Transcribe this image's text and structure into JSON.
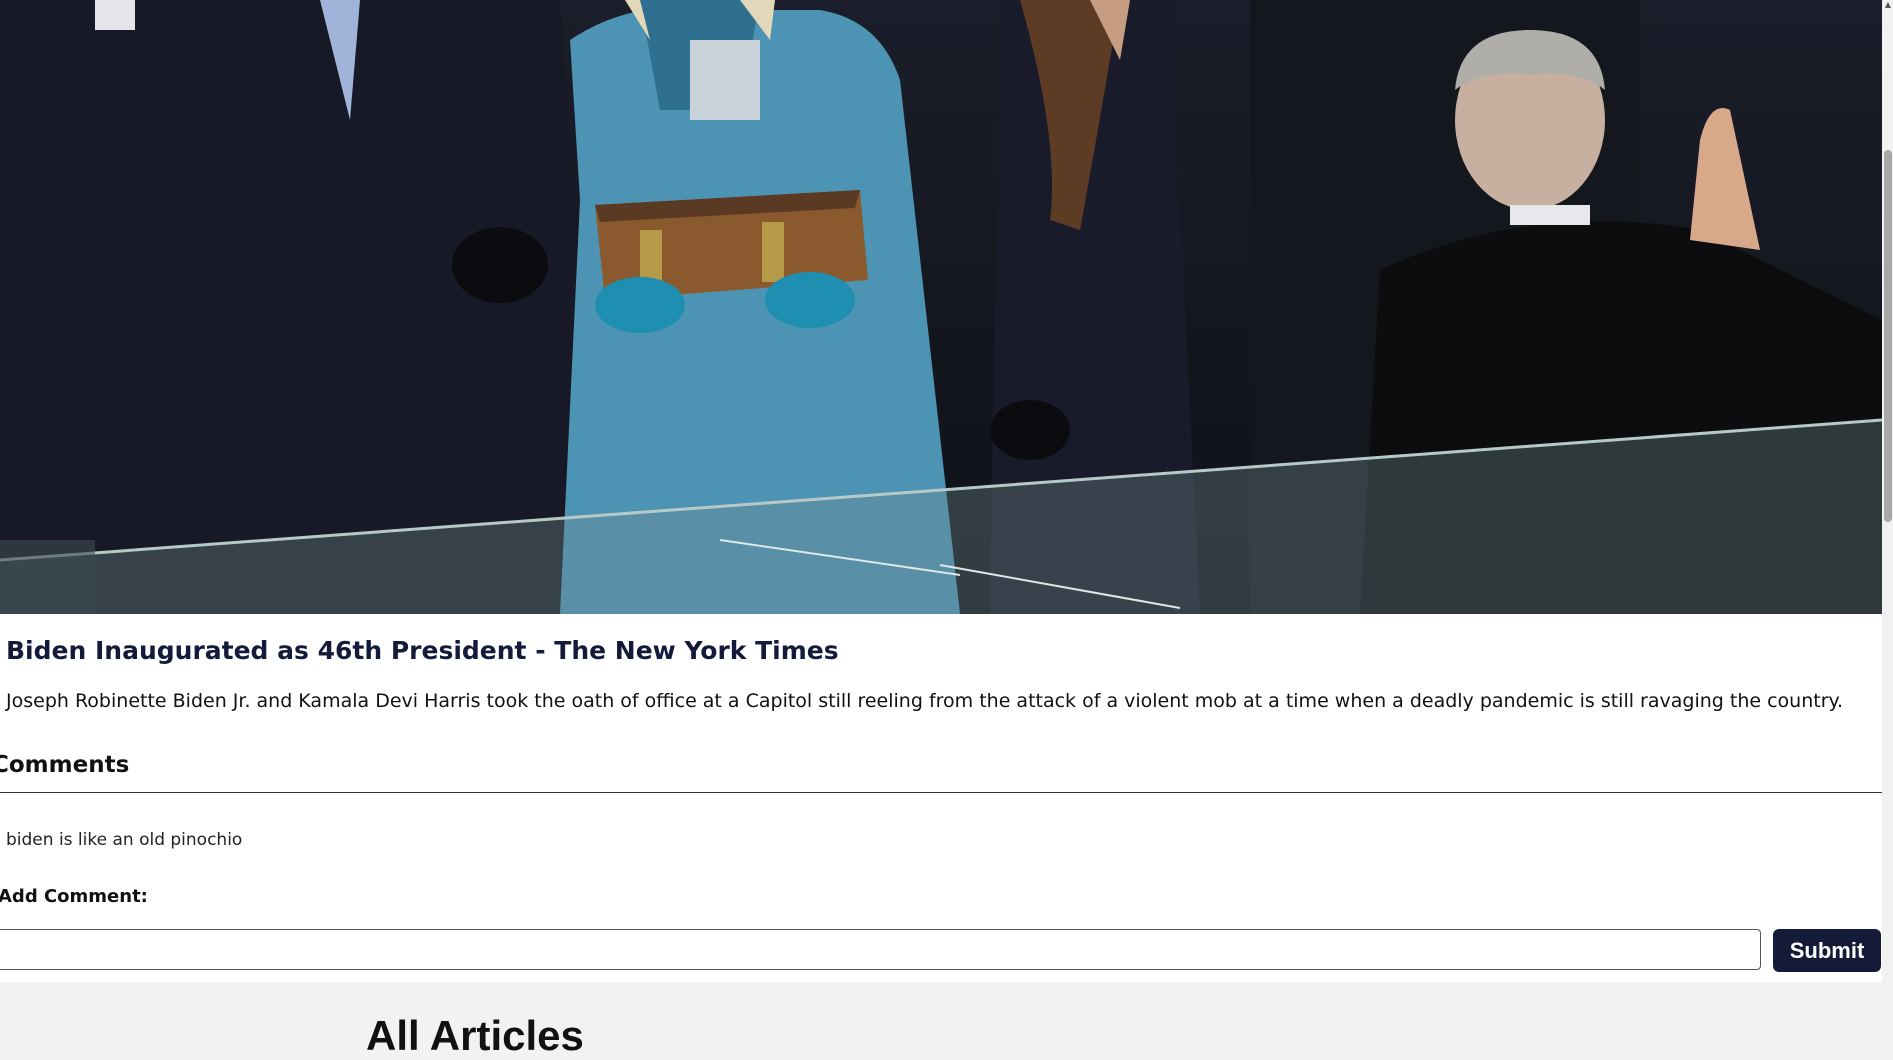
{
  "article": {
    "image_alt": "Inauguration oath-of-office photo",
    "title": "Biden Inaugurated as 46th President - The New York Times",
    "description": "Joseph Robinette Biden Jr. and Kamala Devi Harris took the oath of office at a Capitol still reeling from the attack of a violent mob at a time when a deadly pandemic is still ravaging the country."
  },
  "comments": {
    "heading": "Comments",
    "items": [
      {
        "text": "biden is like an old pinochio"
      }
    ],
    "add_label": "Add Comment:",
    "input_value": "",
    "submit_label": "Submit"
  },
  "all_articles": {
    "heading": "All Articles"
  },
  "colors": {
    "title_navy": "#131a3a",
    "button_navy": "#141b38",
    "page_bg": "#f2f2f2"
  },
  "icons": {
    "scroll_up": "scroll-up-arrow-icon"
  }
}
